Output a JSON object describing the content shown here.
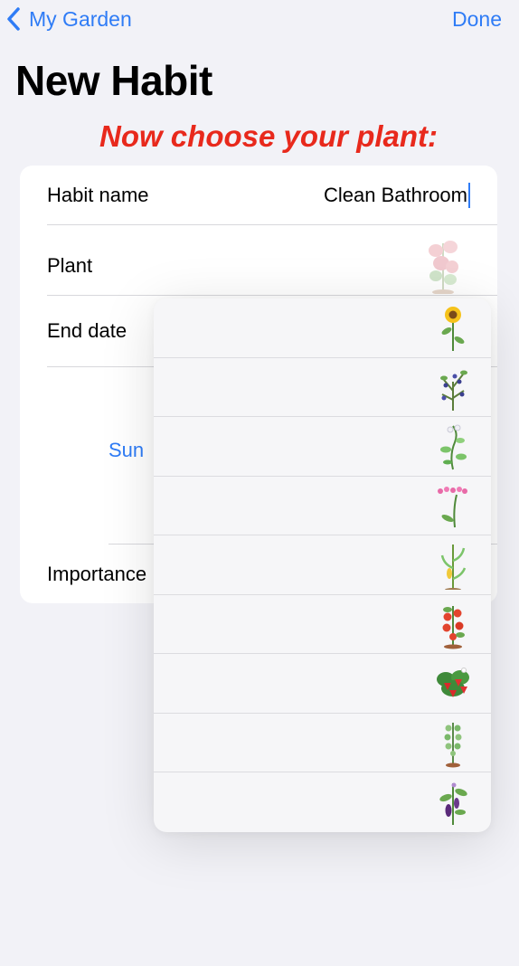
{
  "nav": {
    "back_label": "My Garden",
    "done_label": "Done"
  },
  "page": {
    "title": "New Habit",
    "instruction": "Now choose your plant:"
  },
  "form": {
    "habit_name_label": "Habit name",
    "habit_name_value": "Clean Bathroom",
    "plant_label": "Plant",
    "end_date_label": "End date",
    "sun_label": "Sun",
    "importance_label": "Importance"
  },
  "plant_options": [
    {
      "icon": "sunflower-icon"
    },
    {
      "icon": "blueberry-plant-icon"
    },
    {
      "icon": "pea-plant-icon"
    },
    {
      "icon": "pink-flower-stem-icon"
    },
    {
      "icon": "corn-plant-icon"
    },
    {
      "icon": "tomato-plant-icon"
    },
    {
      "icon": "strawberry-plant-icon"
    },
    {
      "icon": "dill-plant-icon"
    },
    {
      "icon": "eggplant-plant-icon"
    }
  ],
  "colors": {
    "accent": "#2f7cf6",
    "instruction": "#e8291c",
    "background": "#f2f2f7"
  }
}
